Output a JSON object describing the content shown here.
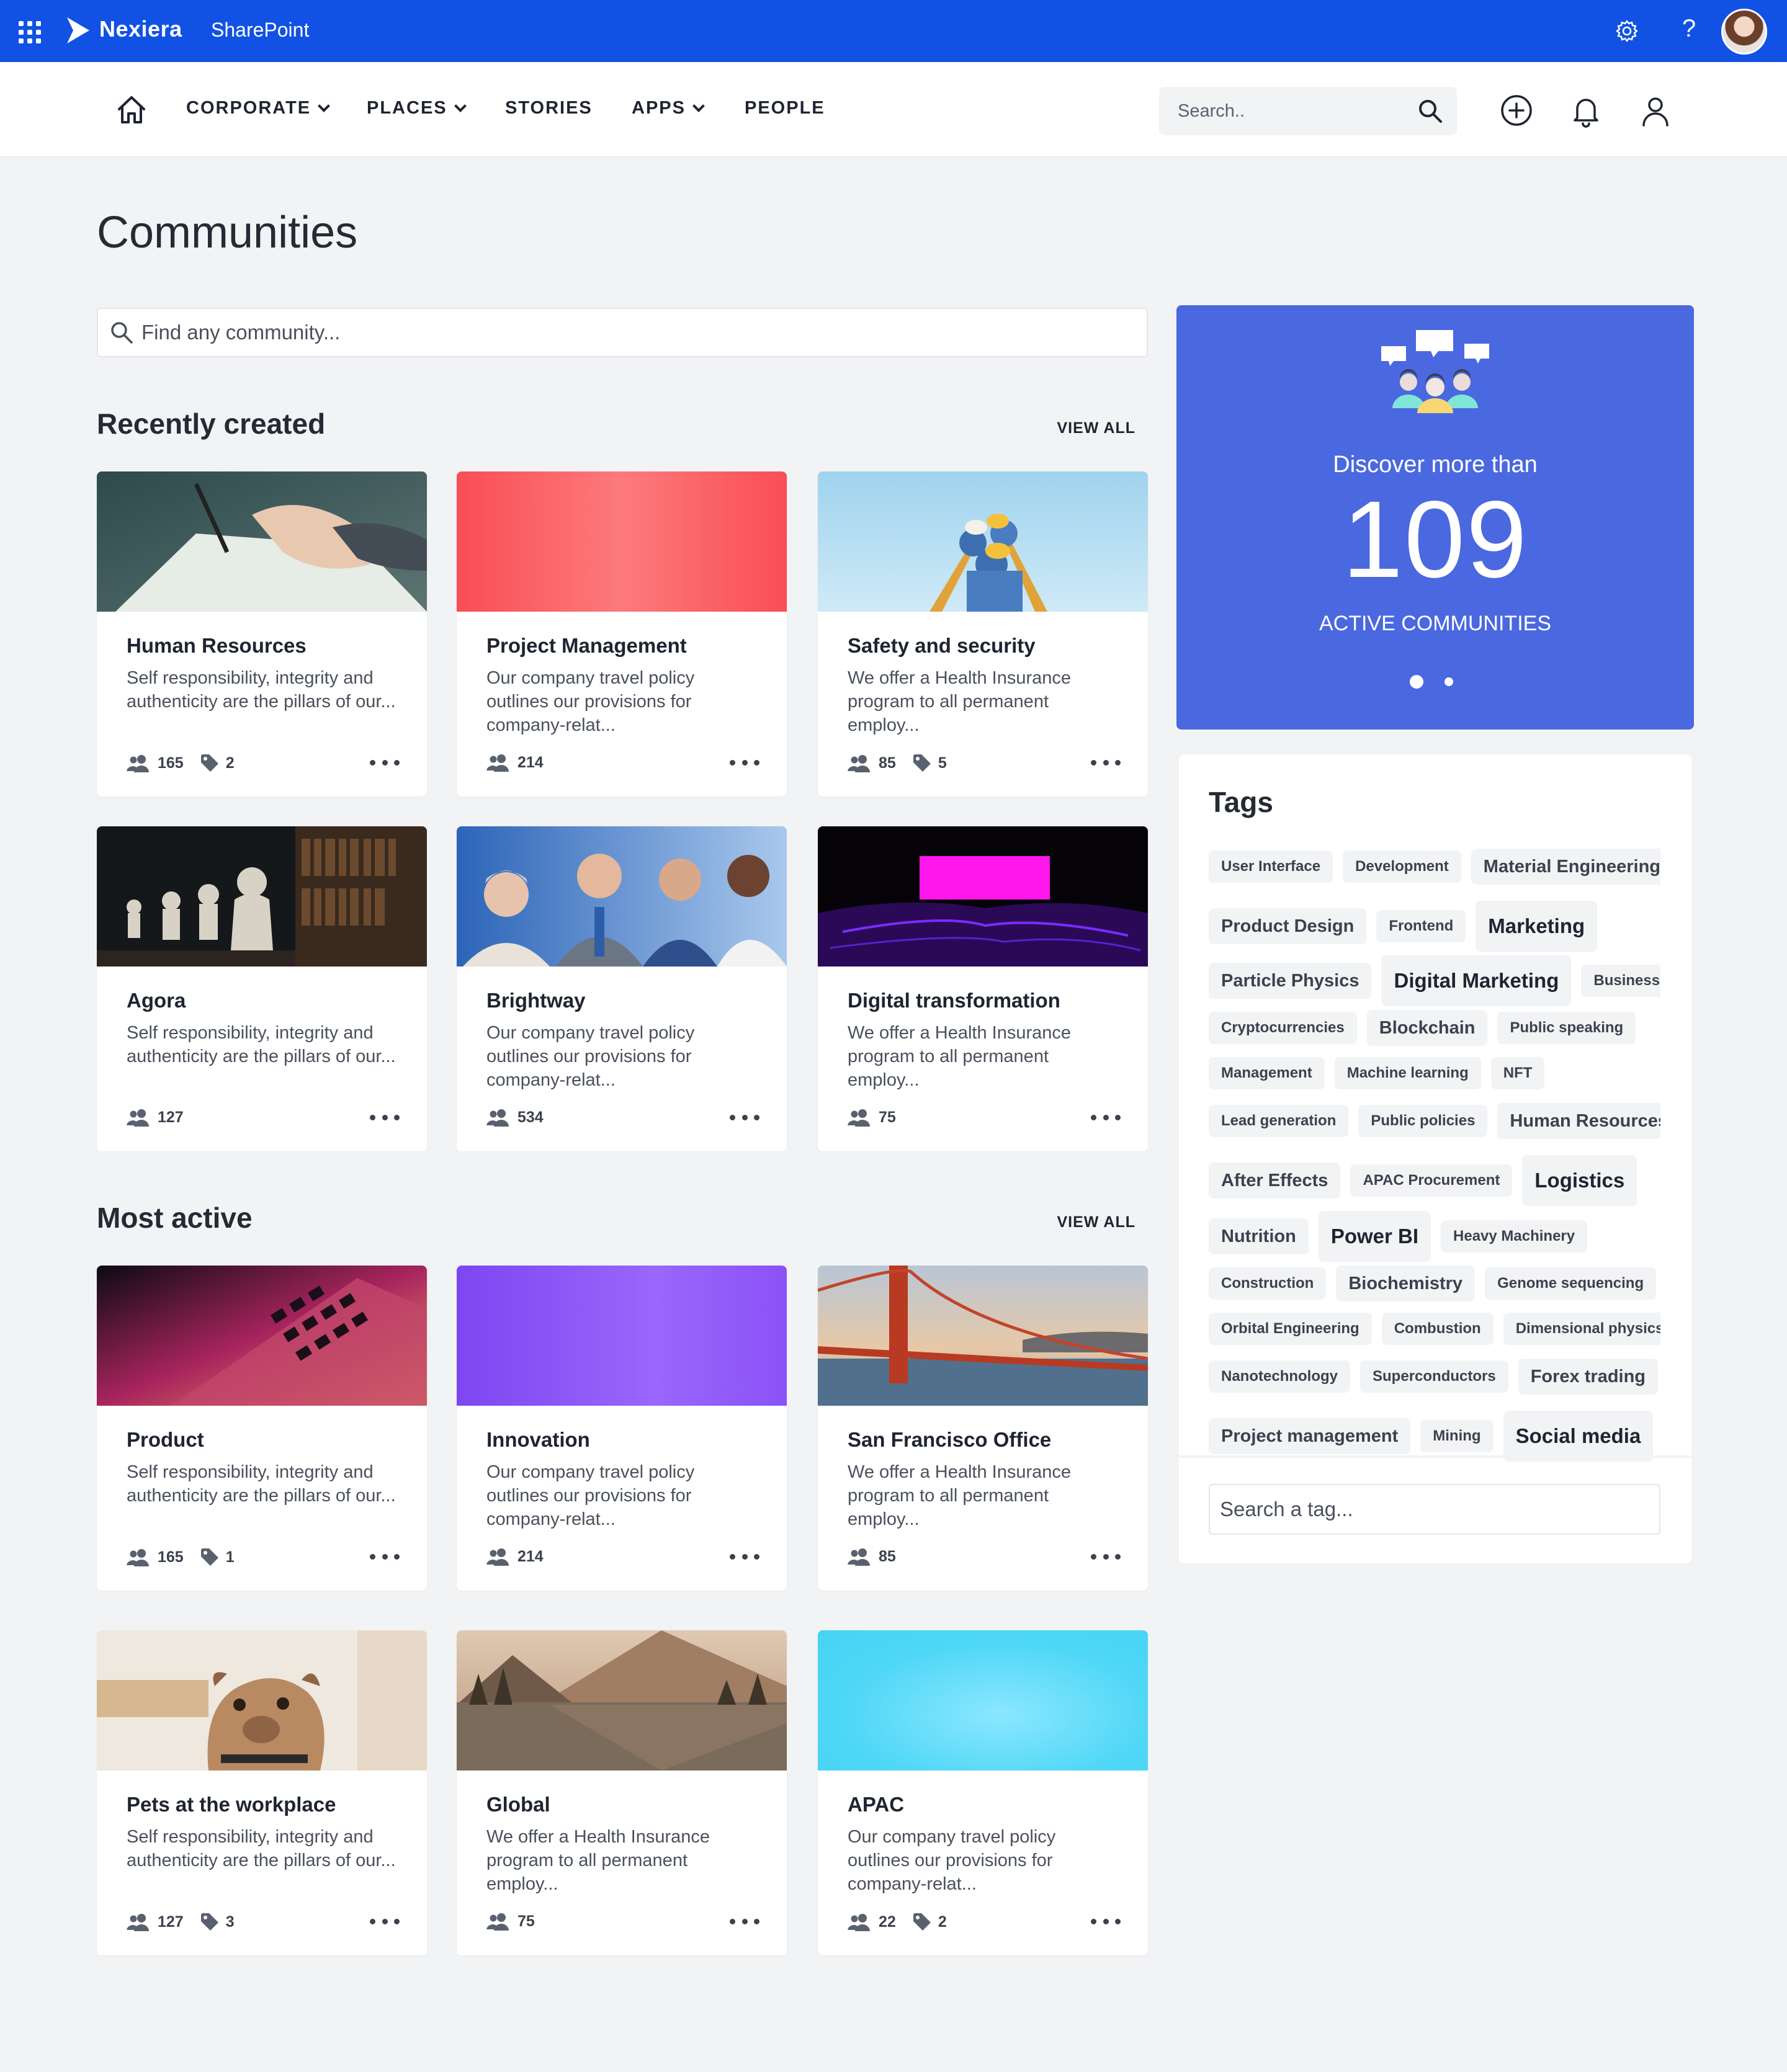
{
  "suitebar": {
    "brand": "Nexiera",
    "app": "SharePoint",
    "help_glyph": "?"
  },
  "nav": {
    "items": [
      {
        "label": "CORPORATE",
        "has_dropdown": true
      },
      {
        "label": "PLACES",
        "has_dropdown": true
      },
      {
        "label": "STORIES",
        "has_dropdown": false
      },
      {
        "label": "APPS",
        "has_dropdown": true
      },
      {
        "label": "PEOPLE",
        "has_dropdown": false
      }
    ],
    "search_placeholder": "Search.."
  },
  "page": {
    "title": "Communities",
    "search_placeholder": "Find any community..."
  },
  "recent": {
    "title": "Recently created",
    "view_all": "VIEW ALL",
    "cards": [
      {
        "title": "Human Resources",
        "desc": "Self responsibility, integrity and authenticity are the pillars of our...",
        "members": "165",
        "tags": "2",
        "image": "hand-writing-photo"
      },
      {
        "title": "Project Management",
        "desc": "Our company travel policy outlines our provisions for company-relat...",
        "members": "214",
        "tags": "",
        "image": "red-gradient"
      },
      {
        "title": "Safety and security",
        "desc": "We offer a Health Insurance program to all permanent employ...",
        "members": "85",
        "tags": "5",
        "image": "workers-helmets-photo"
      },
      {
        "title": "Agora",
        "desc": "Self responsibility, integrity and authenticity are the pillars of our...",
        "members": "127",
        "tags": "",
        "image": "library-busts-photo"
      },
      {
        "title": "Brightway",
        "desc": "Our company travel policy outlines our provisions for company-relat...",
        "members": "534",
        "tags": "",
        "image": "business-team-photo"
      },
      {
        "title": "Digital transformation",
        "desc": "We offer a Health Insurance program to all permanent employ...",
        "members": "75",
        "tags": "",
        "image": "neon-landscape-photo"
      }
    ]
  },
  "active": {
    "title": "Most active",
    "view_all": "VIEW ALL",
    "cards": [
      {
        "title": "Product",
        "desc": "Self responsibility, integrity and authenticity are the pillars of our...",
        "members": "165",
        "tags": "1",
        "image": "laptop-keyboard-photo"
      },
      {
        "title": "Innovation",
        "desc": "Our company travel policy outlines our provisions for company-relat...",
        "members": "214",
        "tags": "",
        "image": "purple-gradient"
      },
      {
        "title": "San Francisco Office",
        "desc": "We offer a Health Insurance program to all permanent employ...",
        "members": "85",
        "tags": "",
        "image": "golden-gate-photo"
      },
      {
        "title": "Pets at the workplace",
        "desc": "Self responsibility, integrity and authenticity are the pillars of our...",
        "members": "127",
        "tags": "3",
        "image": "dog-photo"
      },
      {
        "title": "Global",
        "desc": "We offer a Health Insurance program to all permanent employ...",
        "members": "75",
        "tags": "",
        "image": "mountain-lake-photo"
      },
      {
        "title": "APAC",
        "desc": "Our company travel policy outlines our provisions for company-relat...",
        "members": "22",
        "tags": "2",
        "image": "cyan-gradient"
      }
    ]
  },
  "promo": {
    "line1": "Discover more than",
    "number": "109",
    "line2": "ACTIVE COMMUNITIES",
    "slide_active": 1,
    "slide_count": 2
  },
  "tags": {
    "title": "Tags",
    "rows": [
      [
        {
          "t": "User Interface",
          "s": "sm"
        },
        {
          "t": "Development",
          "s": "sm"
        },
        {
          "t": "Material Engineering",
          "s": "md"
        }
      ],
      [
        {
          "t": "Product Design",
          "s": "md"
        },
        {
          "t": "Frontend",
          "s": "sm"
        },
        {
          "t": "Marketing",
          "s": "lg"
        }
      ],
      [
        {
          "t": "Particle Physics",
          "s": "md"
        },
        {
          "t": "Digital Marketing",
          "s": "lg"
        },
        {
          "t": "Business",
          "s": "sm"
        }
      ],
      [
        {
          "t": "Cryptocurrencies",
          "s": "sm"
        },
        {
          "t": "Blockchain",
          "s": "md"
        },
        {
          "t": "Public speaking",
          "s": "sm"
        }
      ],
      [
        {
          "t": "Management",
          "s": "sm"
        },
        {
          "t": "Machine learning",
          "s": "sm"
        },
        {
          "t": "NFT",
          "s": "sm"
        }
      ],
      [
        {
          "t": "Lead generation",
          "s": "sm"
        },
        {
          "t": "Public policies",
          "s": "sm"
        },
        {
          "t": "Human Resources",
          "s": "md"
        }
      ],
      [
        {
          "t": "After Effects",
          "s": "md"
        },
        {
          "t": "APAC Procurement",
          "s": "sm"
        },
        {
          "t": "Logistics",
          "s": "lg"
        }
      ],
      [
        {
          "t": "Nutrition",
          "s": "md"
        },
        {
          "t": "Power BI",
          "s": "lg"
        },
        {
          "t": "Heavy Machinery",
          "s": "sm"
        }
      ],
      [
        {
          "t": "Construction",
          "s": "sm"
        },
        {
          "t": "Biochemistry",
          "s": "md"
        },
        {
          "t": "Genome sequencing",
          "s": "sm"
        }
      ],
      [
        {
          "t": "Orbital Engineering",
          "s": "sm"
        },
        {
          "t": "Combustion",
          "s": "sm"
        },
        {
          "t": "Dimensional physics",
          "s": "sm"
        }
      ],
      [
        {
          "t": "Nanotechnology",
          "s": "sm"
        },
        {
          "t": "Superconductors",
          "s": "sm"
        },
        {
          "t": "Forex trading",
          "s": "md"
        }
      ],
      [
        {
          "t": "Project management",
          "s": "md"
        },
        {
          "t": "Mining",
          "s": "sm"
        },
        {
          "t": "Social media",
          "s": "lg"
        }
      ]
    ],
    "search_placeholder": "Search a tag..."
  }
}
